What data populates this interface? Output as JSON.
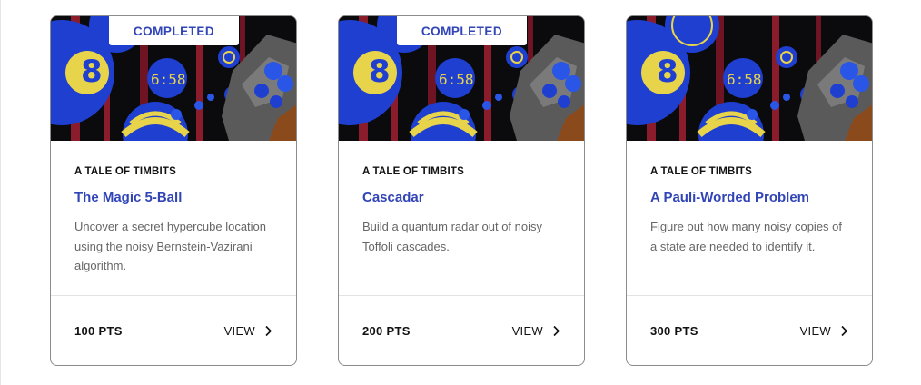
{
  "cards": [
    {
      "badge": "COMPLETED",
      "series": "A TALE OF TIMBITS",
      "title": "The Magic 5-Ball",
      "description": "Uncover a secret hypercube location using the noisy Bernstein-Vazirani algorithm.",
      "points": "100 PTS",
      "view_label": "VIEW",
      "image_icon": "timbits-illustration",
      "clock_text": "6:58",
      "ball_number": "8"
    },
    {
      "badge": "COMPLETED",
      "series": "A TALE OF TIMBITS",
      "title": "Cascadar",
      "description": "Build a quantum radar out of noisy Toffoli cascades.",
      "points": "200 PTS",
      "view_label": "VIEW",
      "image_icon": "timbits-illustration",
      "clock_text": "6:58",
      "ball_number": "8"
    },
    {
      "series": "A TALE OF TIMBITS",
      "title": "A Pauli-Worded Problem",
      "description": "Figure out how many noisy copies of a state are needed to identify it.",
      "points": "300 PTS",
      "view_label": "VIEW",
      "image_icon": "timbits-illustration",
      "clock_text": "6:58",
      "ball_number": "8"
    }
  ],
  "colors": {
    "accent": "#3145b7",
    "ball_blue": "#1f3fd0",
    "ball_yellow": "#e8d44a",
    "stripe_red": "#8a1c2c",
    "border": "#8c8c8c"
  }
}
